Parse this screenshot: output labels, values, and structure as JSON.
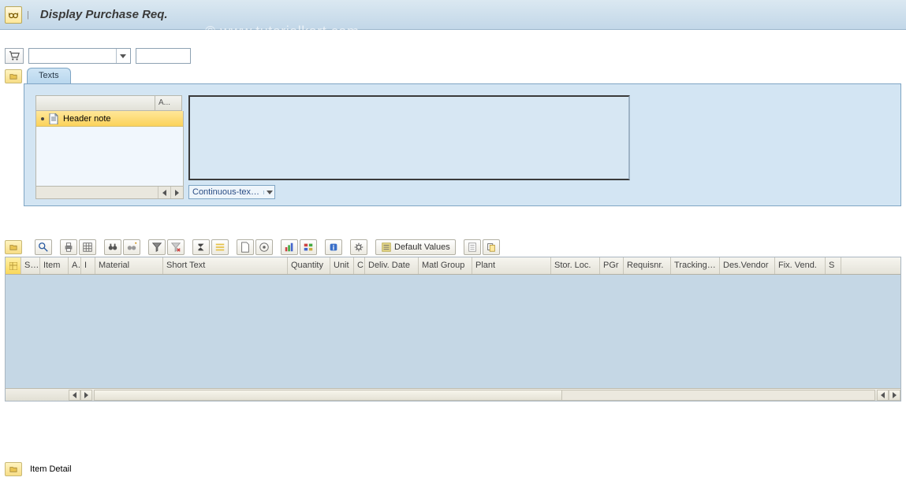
{
  "titlebar": {
    "title": "Display Purchase Req."
  },
  "watermark": "© www.tutorialkart.com",
  "header": {
    "combo1_value": "",
    "combo2_value": ""
  },
  "texts_tab": {
    "label": "Texts",
    "tree": {
      "col_a_label": "A...",
      "items": [
        {
          "label": "Header note"
        }
      ]
    },
    "editor_mode_value": "Continuous-tex…"
  },
  "alv": {
    "default_values_label": "Default Values",
    "columns": [
      "St…",
      "Item",
      "A",
      "I",
      "Material",
      "Short Text",
      "Quantity",
      "Unit",
      "C",
      "Deliv. Date",
      "Matl Group",
      "Plant",
      "Stor. Loc.",
      "PGr",
      "Requisnr.",
      "Tracking…",
      "Des.Vendor",
      "Fix. Vend.",
      "S"
    ]
  },
  "item_detail_label": "Item Detail"
}
